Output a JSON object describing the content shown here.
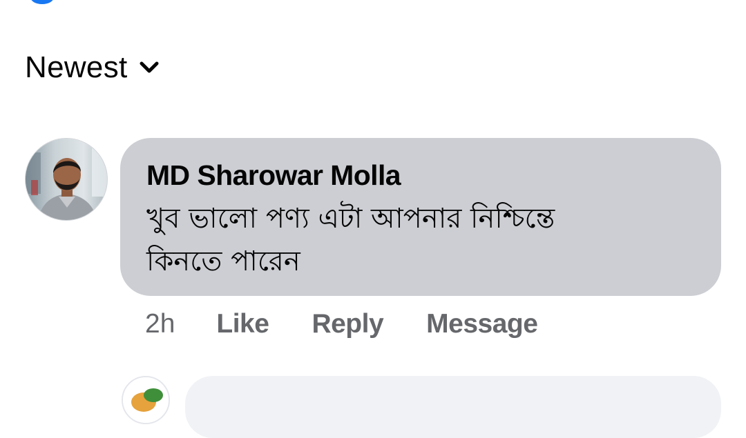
{
  "sort": {
    "label": "Newest"
  },
  "comment": {
    "author": "MD Sharowar Molla",
    "text_line_1": "খুব ভালো পণ্য এটা আপনার নিশ্চিন্তে",
    "text_line_2": "কিনতে পারেন",
    "time": "2h",
    "like_label": "Like",
    "reply_label": "Reply",
    "message_label": "Message"
  },
  "icons": {
    "sort_chevron": "chevron-down-icon",
    "avatar": "user-avatar",
    "next_avatar": "user-avatar"
  },
  "colors": {
    "bubble": "#ccced3",
    "secondary_text": "#65676b",
    "accent": "#1877f2"
  }
}
